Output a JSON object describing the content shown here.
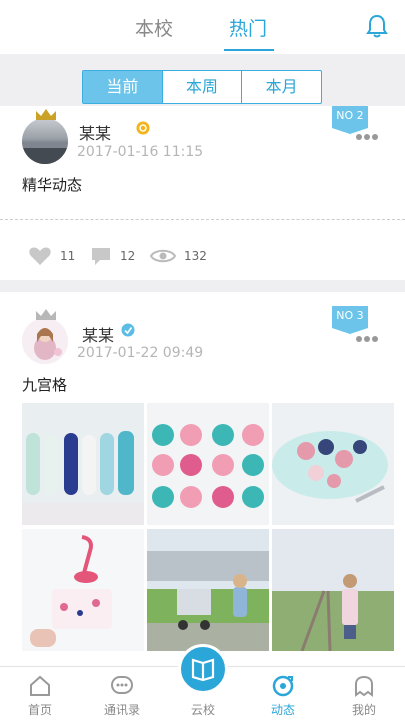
{
  "header": {
    "tabs": [
      {
        "label": "本校",
        "active": false
      },
      {
        "label": "热门",
        "active": true
      }
    ],
    "bell_icon": "bell-icon"
  },
  "filter": {
    "options": [
      {
        "label": "当前",
        "active": true
      },
      {
        "label": "本周",
        "active": false
      },
      {
        "label": "本月",
        "active": false
      }
    ]
  },
  "posts": [
    {
      "name": "某某",
      "time": "2017-01-16 11:15",
      "rank": "NO 2",
      "text": "精华动态",
      "likes": "11",
      "comments": "12",
      "views": "132"
    },
    {
      "name": "某某",
      "time": "2017-01-22 09:49",
      "rank": "NO 3",
      "text": "九宫格"
    }
  ],
  "bottom_nav": {
    "items": [
      {
        "label": "首页",
        "icon": "home-icon"
      },
      {
        "label": "通讯录",
        "icon": "contacts-icon"
      },
      {
        "label": "云校",
        "icon": "book-icon"
      },
      {
        "label": "动态",
        "icon": "moments-icon",
        "active": true
      },
      {
        "label": "我的",
        "icon": "profile-icon"
      }
    ]
  },
  "colors": {
    "accent": "#2ba6d8",
    "rank_badge": "#6cc4ea",
    "background": "#efeff1"
  }
}
